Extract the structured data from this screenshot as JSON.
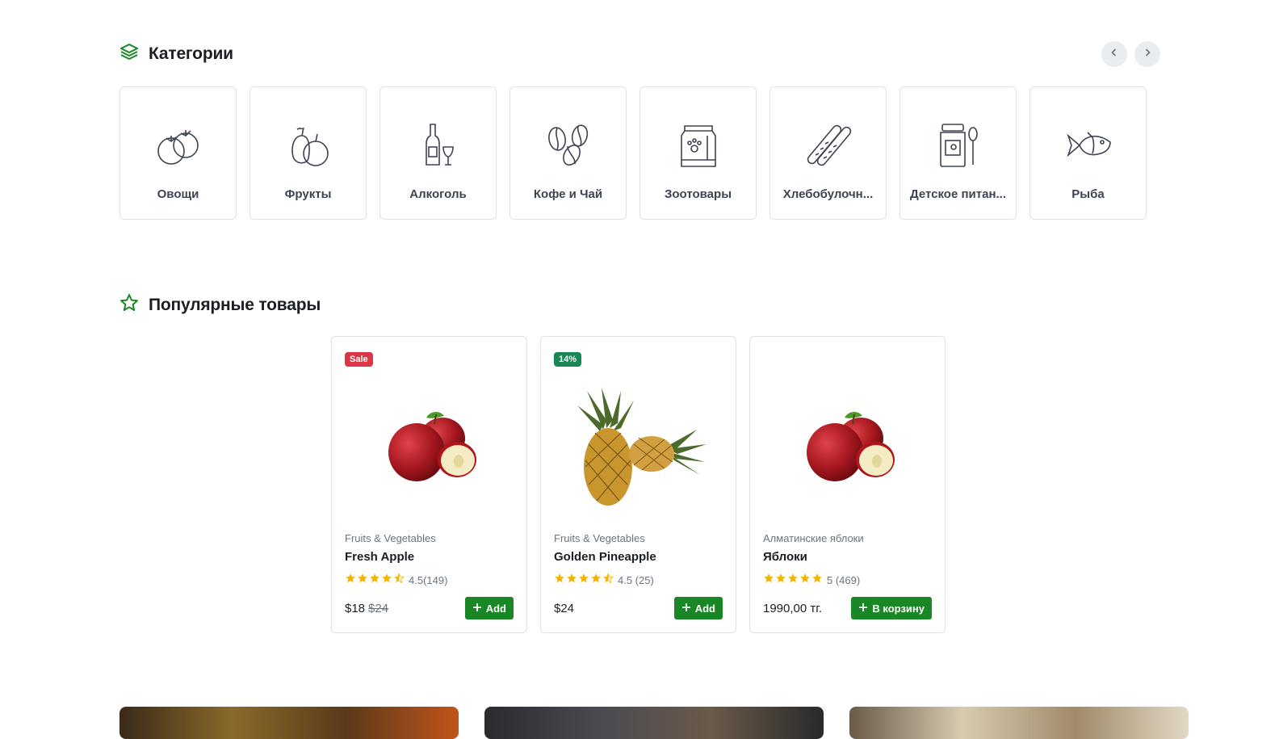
{
  "categories_section": {
    "title": "Категории",
    "items": [
      {
        "label": "Овощи",
        "icon": "tomato-icon"
      },
      {
        "label": "Фрукты",
        "icon": "fruit-icon"
      },
      {
        "label": "Алкоголь",
        "icon": "wine-icon"
      },
      {
        "label": "Кофе и Чай",
        "icon": "coffee-beans-icon"
      },
      {
        "label": "Зоотовары",
        "icon": "pet-food-bag-icon"
      },
      {
        "label": "Хлебобулочн...",
        "icon": "baguette-icon"
      },
      {
        "label": "Детское питан...",
        "icon": "baby-food-jar-icon"
      },
      {
        "label": "Рыба",
        "icon": "fish-icon"
      }
    ]
  },
  "popular_section": {
    "title": "Популярные товары",
    "products": [
      {
        "badge": "Sale",
        "category": "Fruits & Vegetables",
        "name": "Fresh Apple",
        "rating": 4.5,
        "rating_text": "4.5(149)",
        "price": "$18",
        "old_price": "$24",
        "button": "Add"
      },
      {
        "badge": "14%",
        "category": "Fruits & Vegetables",
        "name": "Golden Pineapple",
        "rating": 4.5,
        "rating_text": "4.5 (25)",
        "price": "$24",
        "old_price": "",
        "button": "Add"
      },
      {
        "badge": "",
        "category": "Алматинские яблоки",
        "name": "Яблоки",
        "rating": 5,
        "rating_text": "5 (469)",
        "price": "1990,00 тг.",
        "old_price": "",
        "button": "В корзину"
      }
    ]
  },
  "colors": {
    "accent": "#198726",
    "sale": "#dc3545",
    "discount": "#198754",
    "star": "#f5b301"
  }
}
